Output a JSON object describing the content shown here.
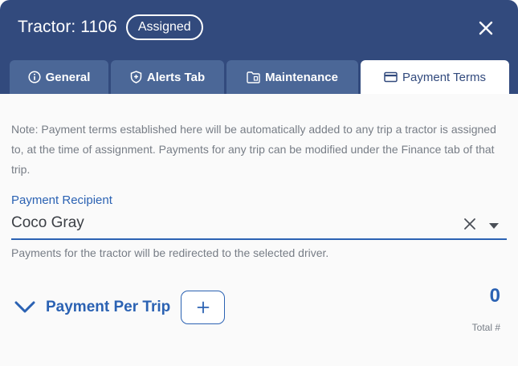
{
  "header": {
    "title": "Tractor: 1106",
    "status_badge": "Assigned"
  },
  "tabs": [
    {
      "label": "General",
      "icon": "info-icon",
      "active": false
    },
    {
      "label": "Alerts Tab",
      "icon": "shield-icon",
      "active": false
    },
    {
      "label": "Maintenance",
      "icon": "folder-icon",
      "active": false
    },
    {
      "label": "Payment Terms",
      "icon": "credit-card-icon",
      "active": true
    }
  ],
  "content": {
    "note": "Note: Payment terms established here will be automatically added to any trip a tractor is assigned to, at the time of assignment. Payments for any trip can be modified under the Finance tab of that trip.",
    "payment_recipient": {
      "label": "Payment Recipient",
      "value": "Coco Gray",
      "helper": "Payments for the tractor will be redirected to the selected driver."
    },
    "payment_per_trip": {
      "title": "Payment Per Trip",
      "count": "0",
      "count_label": "Total #"
    }
  },
  "colors": {
    "header_bg": "#324a7d",
    "tab_bg": "#4b6797",
    "accent": "#2b62b3",
    "muted_text": "#777d86"
  }
}
